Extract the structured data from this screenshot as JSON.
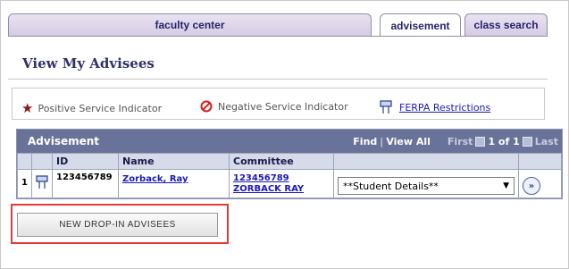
{
  "tabs": [
    {
      "label": "faculty center",
      "active": false
    },
    {
      "label": "advisement",
      "active": true
    },
    {
      "label": "class search",
      "active": false
    }
  ],
  "page": {
    "title": "View My Advisees"
  },
  "legend": {
    "positive": "Positive Service Indicator",
    "negative": "Negative Service Indicator",
    "ferpa": "FERPA Restrictions"
  },
  "grid": {
    "caption": "Advisement",
    "find": "Find",
    "separator": "|",
    "view_all": "View All",
    "first": "First",
    "range": "1 of 1",
    "last": "Last",
    "columns": {
      "id": "ID",
      "name": "Name",
      "committee": "Committee"
    },
    "rows": [
      {
        "num": "1",
        "id": "123456789",
        "name": "Zorback, Ray",
        "committee_id": "123456789",
        "committee_name": "ZORBACK RAY",
        "action": "**Student Details**"
      }
    ]
  },
  "buttons": {
    "new_dropin": "NEW DROP-IN ADVISEES"
  },
  "colors": {
    "header_bg": "#69739a",
    "highlight": "#e03a3a",
    "link": "#1a1ab8"
  }
}
